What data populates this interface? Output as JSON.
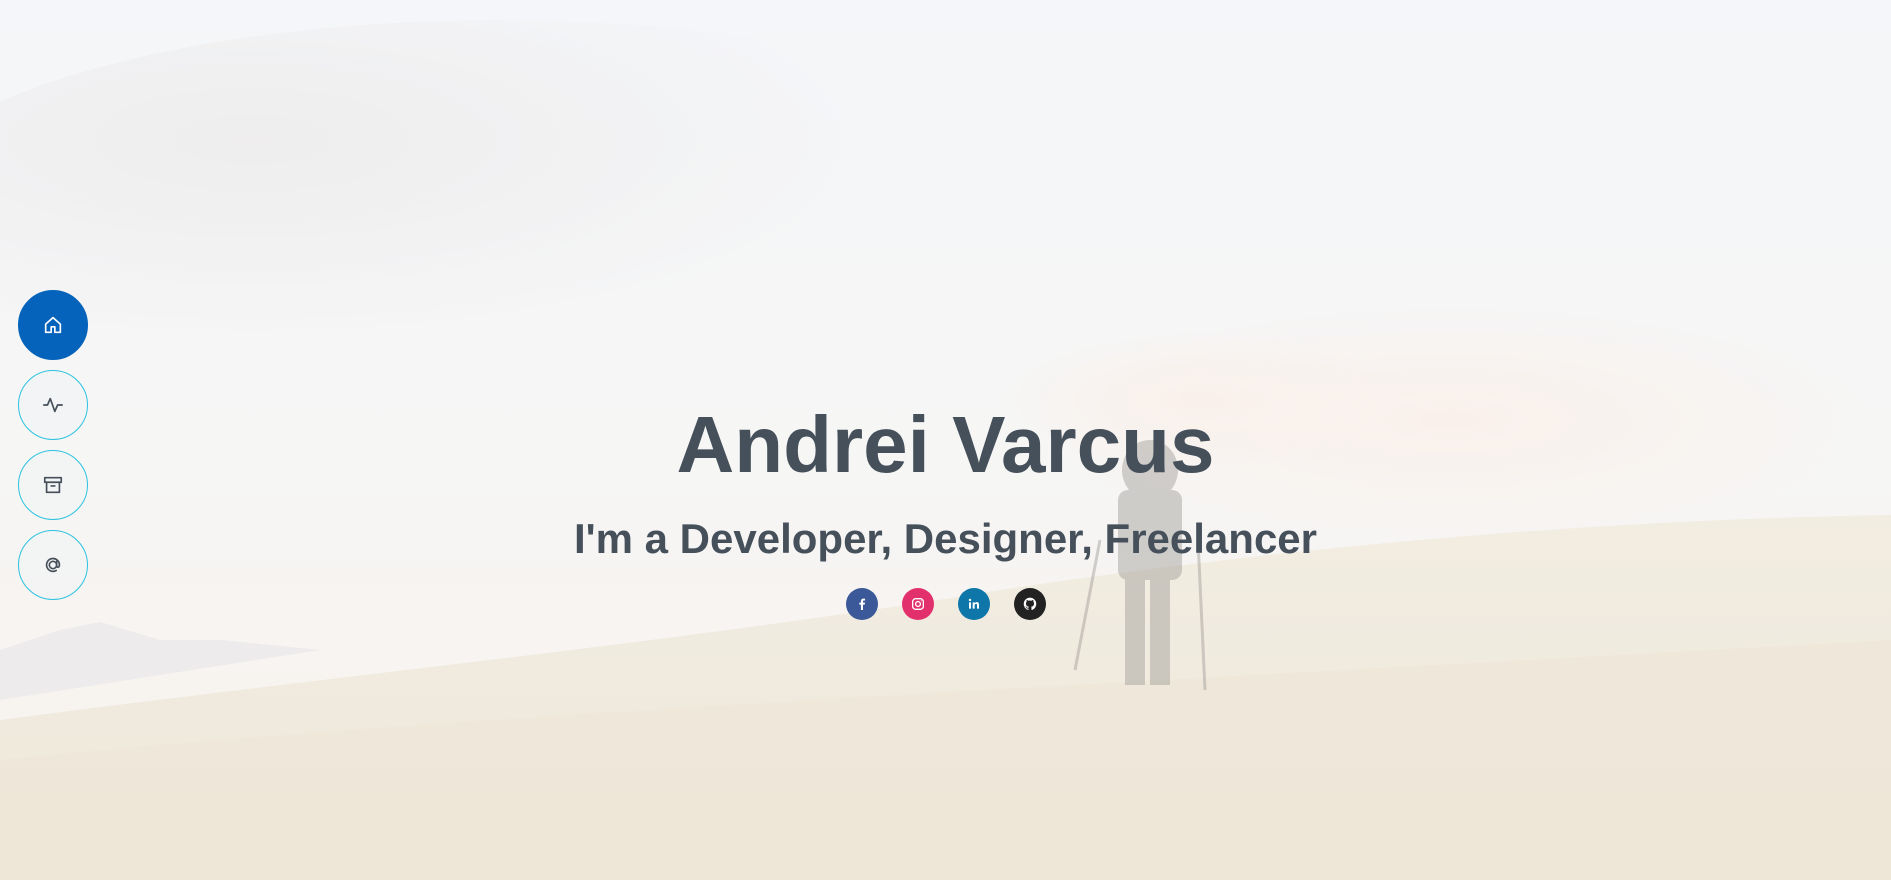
{
  "hero": {
    "name": "Andrei Varcus",
    "tagline": "I'm a Developer, Designer, Freelancer"
  },
  "side_nav": {
    "items": [
      {
        "icon": "home-icon",
        "active": true
      },
      {
        "icon": "activity-icon",
        "active": false
      },
      {
        "icon": "archive-icon",
        "active": false
      },
      {
        "icon": "at-sign-icon",
        "active": false
      }
    ]
  },
  "socials": [
    {
      "icon": "facebook-icon",
      "color": "#3b5998"
    },
    {
      "icon": "instagram-icon",
      "color": "#e1306c"
    },
    {
      "icon": "linkedin-icon",
      "color": "#0e76a8"
    },
    {
      "icon": "github-icon",
      "color": "#222222"
    }
  ],
  "colors": {
    "accent": "#0563bb",
    "nav_border": "#2cc3e0",
    "heading": "#45505b"
  }
}
